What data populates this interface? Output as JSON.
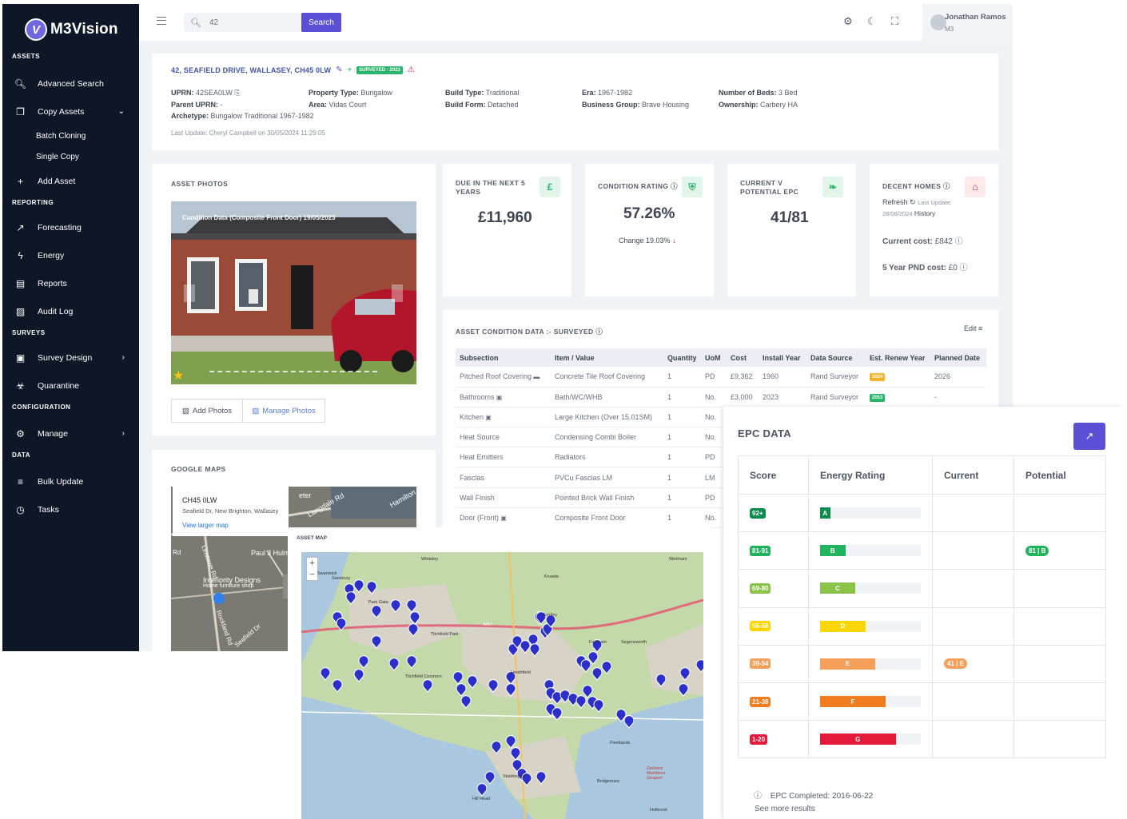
{
  "app": {
    "brand": "M3Vision",
    "brand_mark": "V"
  },
  "sidebar": {
    "sections": {
      "assets": "ASSETS",
      "reporting": "REPORTING",
      "surveys": "SURVEYS",
      "configuration": "CONFIGURATION",
      "data": "DATA"
    },
    "items": {
      "advanced_search": "Advanced Search",
      "copy_assets": "Copy Assets",
      "batch_cloning": "Batch Cloning",
      "single_copy": "Single Copy",
      "add_asset": "Add Asset",
      "forecasting": "Forecasting",
      "energy": "Energy",
      "reports": "Reports",
      "audit_log": "Audit Log",
      "survey_design": "Survey Design",
      "quarantine": "Quarantine",
      "manage": "Manage",
      "bulk_update": "Bulk Update",
      "tasks": "Tasks"
    }
  },
  "topbar": {
    "search_value": "42",
    "search_button": "Search",
    "user_name": "Jonathan Ramos",
    "user_role": "M3"
  },
  "asset": {
    "address": "42, SEAFIELD DRIVE, WALLASEY, CH45 0LW",
    "survey_badge": "SURVEYED - 2023",
    "uprn_label": "UPRN:",
    "uprn": "42SEA0LW",
    "parent_uprn_label": "Parent UPRN:",
    "parent_uprn": "-",
    "archetype_label": "Archetype:",
    "archetype": "Bungalow Traditional 1967-1982",
    "property_type_label": "Property Type:",
    "property_type": "Bungalow",
    "area_label": "Area:",
    "area": "Vidas Court",
    "build_type_label": "Build Type:",
    "build_type": "Traditional",
    "build_form_label": "Build Form:",
    "build_form": "Detached",
    "era_label": "Era:",
    "era": "1967-1982",
    "business_group_label": "Business Group:",
    "business_group": "Brave Housing",
    "beds_label": "Number of Beds:",
    "beds": "3 Bed",
    "ownership_label": "Ownership:",
    "ownership": "Carbery HA",
    "last_update": "Last Update: Cheryl Campbell on 30/05/2024 11:29:05"
  },
  "photos": {
    "title": "ASSET PHOTOS",
    "caption": "Condition Data (Composite Front Door) 19/05/2023",
    "add_button": "Add Photos",
    "manage_button": "Manage Photos"
  },
  "stats": {
    "due": {
      "title_line1": "DUE IN THE NEXT 5",
      "title_line2": "YEARS",
      "value": "£11,960",
      "icon": "£"
    },
    "condition": {
      "title": "CONDITION RATING",
      "value": "57.26%",
      "change": "Change 19.03%"
    },
    "epc": {
      "title_line1": "CURRENT V",
      "title_line2": "POTENTIAL EPC",
      "value": "41/81"
    },
    "decent": {
      "title": "DECENT HOMES",
      "refresh": "Refresh",
      "last_update_label": "Last Update:",
      "last_update": "28/08/2024",
      "history": "History",
      "current_cost_label": "Current cost:",
      "current_cost": "£842",
      "pnd_label": "5 Year PND cost:",
      "pnd": "£0"
    }
  },
  "condition_data": {
    "title": "ASSET CONDITION DATA :- SURVEYED",
    "edit": "Edit",
    "headers": [
      "Subsection",
      "Item / Value",
      "Quantity",
      "UoM",
      "Cost",
      "Install Year",
      "Data Source",
      "Est. Renew Year",
      "Planned Date"
    ],
    "rows": [
      {
        "subsection": "Pitched Roof Covering",
        "item": "Concrete Tile Roof Covering",
        "qty": "1",
        "uom": "PD",
        "cost": "£9,362",
        "install": "1960",
        "source": "Rand Surveyor",
        "renew": "2024",
        "renew_color": "#f0b429",
        "planned": "2026"
      },
      {
        "subsection": "Bathrooms",
        "item": "Bath/WC/WHB",
        "qty": "1",
        "uom": "No.",
        "cost": "£3,000",
        "install": "2023",
        "source": "Rand Surveyor",
        "renew": "2053",
        "renew_color": "#2ab56c",
        "planned": "-"
      },
      {
        "subsection": "Kitchen",
        "item": "Large Kitchen (Over 15.01SM)",
        "qty": "1",
        "uom": "No.",
        "cost": "",
        "install": "",
        "source": "",
        "renew": "",
        "renew_color": "",
        "planned": ""
      },
      {
        "subsection": "Heat Source",
        "item": "Condensing Combi Boiler",
        "qty": "1",
        "uom": "No.",
        "cost": "",
        "install": "",
        "source": "",
        "renew": "",
        "renew_color": "",
        "planned": ""
      },
      {
        "subsection": "Heat Emitters",
        "item": "Radiators",
        "qty": "1",
        "uom": "PD",
        "cost": "",
        "install": "",
        "source": "",
        "renew": "",
        "renew_color": "",
        "planned": ""
      },
      {
        "subsection": "Fascias",
        "item": "PVCu Fascias LM",
        "qty": "1",
        "uom": "LM",
        "cost": "",
        "install": "",
        "source": "",
        "renew": "",
        "renew_color": "",
        "planned": ""
      },
      {
        "subsection": "Wall Finish",
        "item": "Pointed Brick Wall Finish",
        "qty": "1",
        "uom": "PD",
        "cost": "",
        "install": "",
        "source": "",
        "renew": "",
        "renew_color": "",
        "planned": ""
      },
      {
        "subsection": "Door (Front)",
        "item": "Composite Front Door",
        "qty": "1",
        "uom": "No.",
        "cost": "",
        "install": "",
        "source": "",
        "renew": "",
        "renew_color": "",
        "planned": ""
      }
    ],
    "camera_rows": [
      "Bathrooms",
      "Kitchen",
      "Door (Front)"
    ],
    "comment_rows": [
      "Pitched Roof Covering"
    ]
  },
  "google_maps": {
    "title": "GOOGLE MAPS",
    "place_postcode": "CH45 0LW",
    "place_address": "Seafield Dr, New Brighton, Wallasey",
    "view_larger": "View larger map",
    "labels": [
      "Langdale Rd",
      "Hamilton",
      "Paul J Hulm",
      "Interiority Designs",
      "Home furniture shop",
      "Rd",
      "Linstowe Rd",
      "Rockland Rd",
      "Seafield Dr",
      "eter"
    ]
  },
  "asset_map": {
    "title": "ASSET MAP",
    "zoom_in": "+",
    "zoom_out": "−",
    "labels": [
      "Swanwick",
      "Sarisbury",
      "Titchfield Park",
      "Titchfield Common",
      "Heathfield",
      "Fareham",
      "Bridgemary",
      "Fleetlands",
      "Defence Munitions Gosport",
      "Hill Head",
      "Stubbington",
      "Knowle",
      "Funtley",
      "Wickham",
      "Whiteley",
      "Park Gate",
      "M27",
      "Holbrook",
      "Segensworth"
    ]
  },
  "epc_data": {
    "title": "EPC DATA",
    "headers": [
      "Score",
      "Energy Rating",
      "Current",
      "Potential"
    ],
    "rows": [
      {
        "score": "92+",
        "letter": "A",
        "color": "#0e8c4e",
        "fraction": 0.1,
        "current": "",
        "potential": ""
      },
      {
        "score": "81-91",
        "letter": "B",
        "color": "#22b35f",
        "fraction": 0.25,
        "current": "",
        "potential": "81 | B"
      },
      {
        "score": "69-80",
        "letter": "C",
        "color": "#8bc34a",
        "fraction": 0.35,
        "current": "",
        "potential": ""
      },
      {
        "score": "55-68",
        "letter": "D",
        "color": "#ffd500",
        "fraction": 0.45,
        "current": "",
        "potential": ""
      },
      {
        "score": "39-54",
        "letter": "E",
        "color": "#f5a05a",
        "fraction": 0.55,
        "current": "41 | E",
        "potential": ""
      },
      {
        "score": "21-38",
        "letter": "F",
        "color": "#f07d1f",
        "fraction": 0.65,
        "current": "",
        "potential": ""
      },
      {
        "score": "1-20",
        "letter": "G",
        "color": "#e3193a",
        "fraction": 0.75,
        "current": "",
        "potential": ""
      }
    ],
    "completed": "EPC Completed: 2016-06-22",
    "see_more": "See more results"
  }
}
